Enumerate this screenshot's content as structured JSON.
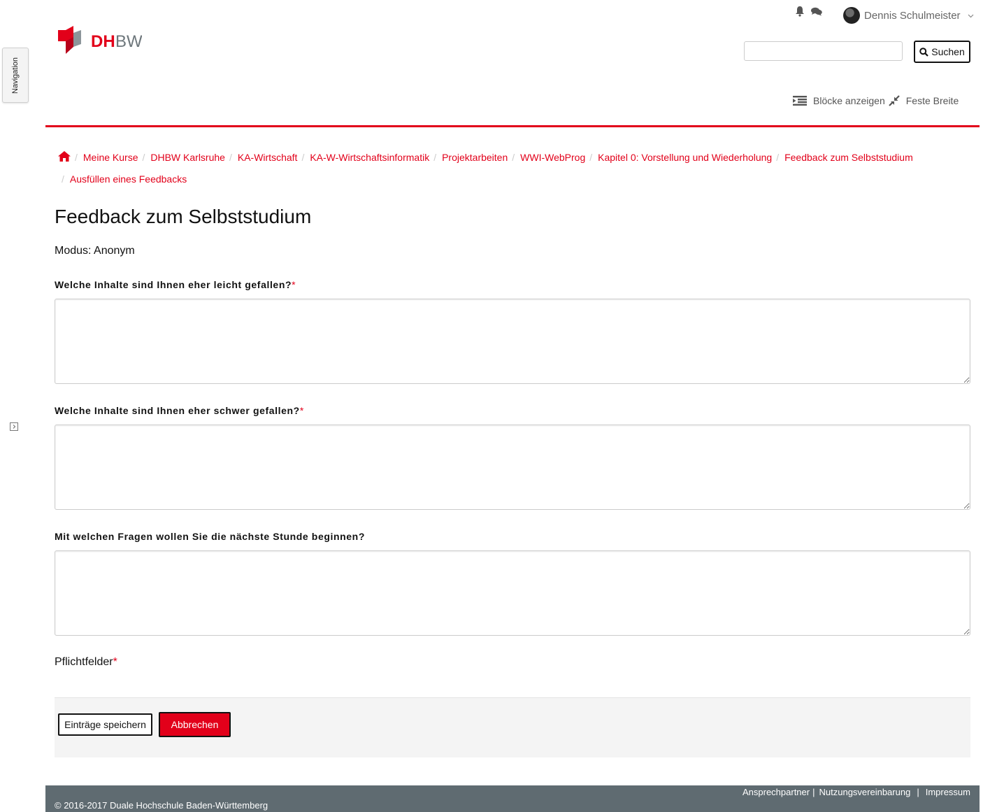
{
  "sidebar": {
    "nav_tab_label": "Navigation"
  },
  "user": {
    "name": "Dennis Schulmeister"
  },
  "brand": {
    "logo_text_dh": "DH",
    "logo_text_bw": "BW",
    "accent": "#e2001a"
  },
  "search": {
    "value": "",
    "button_label": "Suchen"
  },
  "block_controls": {
    "show_blocks": "Blöcke anzeigen",
    "fixed_width": "Feste Breite"
  },
  "breadcrumb": {
    "items": [
      "Meine Kurse",
      "DHBW Karlsruhe",
      "KA-Wirtschaft",
      "KA-W-Wirtschaftsinformatik",
      "Projektarbeiten",
      "WWI-WebProg",
      "Kapitel 0: Vorstellung und Wiederholung",
      "Feedback zum Selbststudium"
    ],
    "current": "Ausfüllen eines Feedbacks"
  },
  "page": {
    "title": "Feedback zum Selbststudium",
    "mode": "Modus: Anonym"
  },
  "questions": [
    {
      "label": "Welche Inhalte sind Ihnen eher leicht gefallen?",
      "required": "*",
      "value": ""
    },
    {
      "label": "Welche Inhalte sind Ihnen eher schwer gefallen?",
      "required": "*",
      "value": ""
    },
    {
      "label": "Mit welchen Fragen wollen Sie die nächste Stunde beginnen?",
      "required": "",
      "value": ""
    }
  ],
  "form": {
    "required_note": "Pflichtfelder",
    "required_marker": "*",
    "save_label": "Einträge speichern",
    "cancel_label": "Abbrechen"
  },
  "footer": {
    "links": [
      "Ansprechpartner",
      "Nutzungsvereinbarung",
      "Impressum"
    ],
    "copyright": "© 2016-2017 Duale Hochschule Baden-Württemberg"
  }
}
